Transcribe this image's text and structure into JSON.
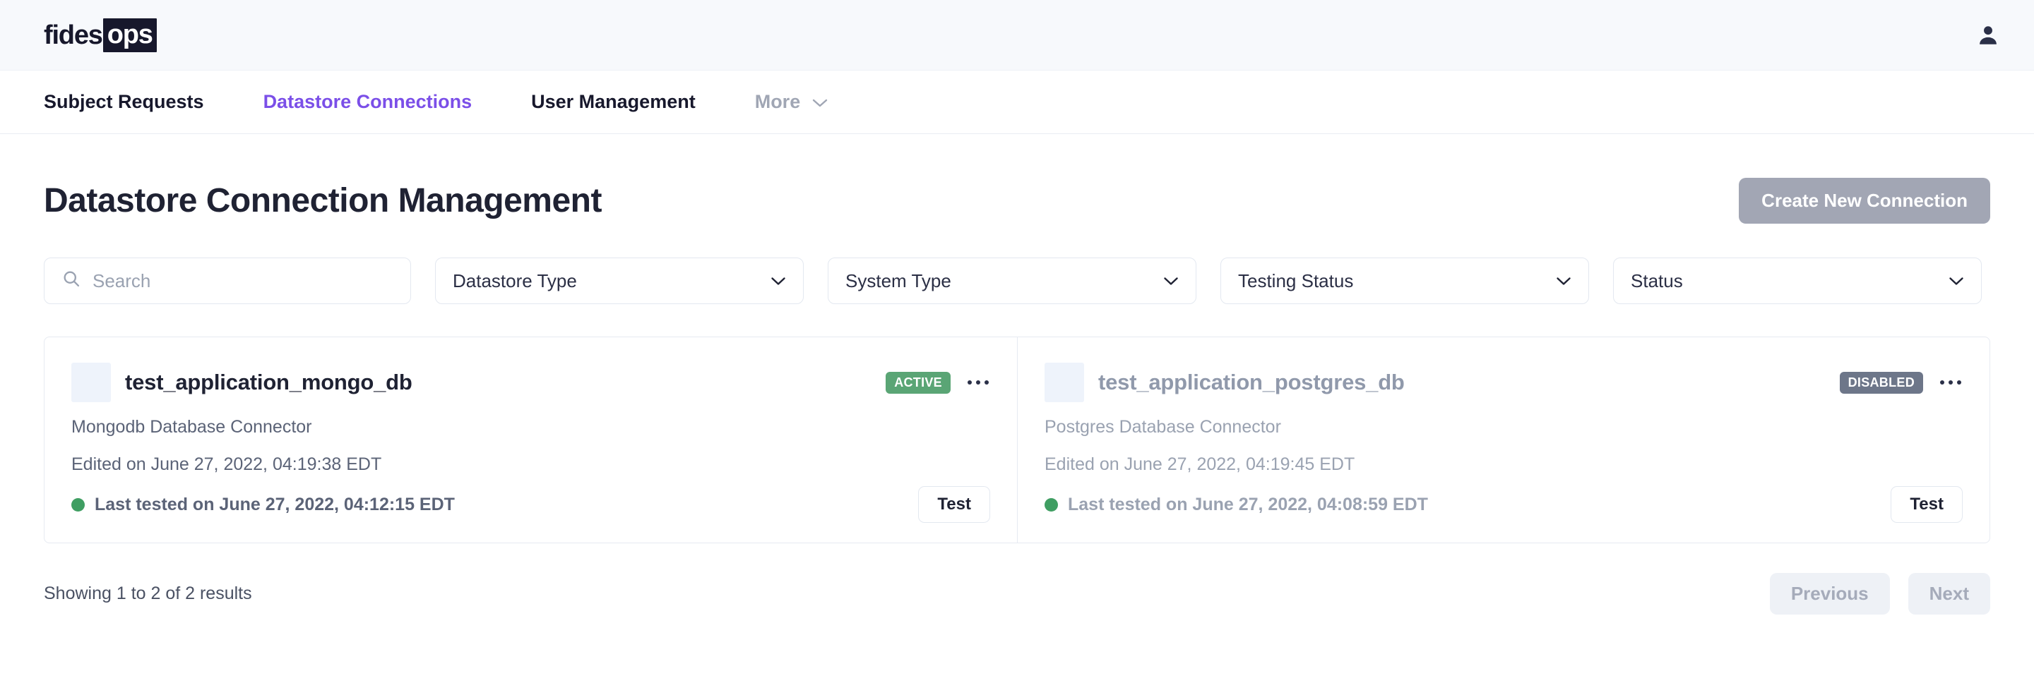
{
  "brand": {
    "logo_primary": "fides",
    "logo_secondary": "ops",
    "accent_color": "#7b4fe8",
    "logo_color": "#17182c"
  },
  "topbar": {
    "user_icon": "user-avatar-icon"
  },
  "nav": {
    "items": [
      {
        "label": "Subject Requests",
        "state": "default"
      },
      {
        "label": "Datastore Connections",
        "state": "active"
      },
      {
        "label": "User Management",
        "state": "default"
      },
      {
        "label": "More",
        "state": "muted",
        "icon": "chevron-down-icon"
      }
    ]
  },
  "header": {
    "title": "Datastore Connection Management",
    "create_button": "Create New Connection"
  },
  "filters": {
    "search": {
      "placeholder": "Search",
      "value": "",
      "icon": "search-icon"
    },
    "selects": [
      {
        "label": "Datastore Type",
        "icon": "chevron-down-icon"
      },
      {
        "label": "System Type",
        "icon": "chevron-down-icon"
      },
      {
        "label": "Testing Status",
        "icon": "chevron-down-icon"
      },
      {
        "label": "Status",
        "icon": "chevron-down-icon"
      }
    ]
  },
  "connections": [
    {
      "name": "test_application_mongo_db",
      "description": "Mongodb Database Connector",
      "edited": "Edited on June 27, 2022, 04:19:38 EDT",
      "last_tested": "Last tested on June 27, 2022, 04:12:15 EDT",
      "badge": "ACTIVE",
      "badge_color": "#5aa575",
      "status_dot_color": "#3f9e62",
      "test_button": "Test",
      "menu_icon": "ellipsis-icon",
      "disabled": false
    },
    {
      "name": "test_application_postgres_db",
      "description": "Postgres Database Connector",
      "edited": "Edited on June 27, 2022, 04:19:45 EDT",
      "last_tested": "Last tested on June 27, 2022, 04:08:59 EDT",
      "badge": "DISABLED",
      "badge_color": "#6d7689",
      "status_dot_color": "#3f9e62",
      "test_button": "Test",
      "menu_icon": "ellipsis-icon",
      "disabled": true
    }
  ],
  "footer": {
    "results": "Showing 1 to 2 of 2 results",
    "previous": "Previous",
    "next": "Next"
  }
}
